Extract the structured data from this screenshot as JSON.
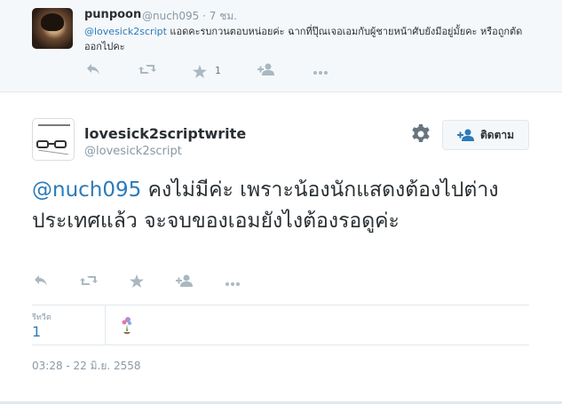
{
  "reply_tweet": {
    "name": "punpoon",
    "handle": "@nuch095",
    "time": "· 7 ชม.",
    "mention": "@lovesick2script",
    "text": " แอดคะรบกวนตอบหน่อยค่ะ ฉากที่ปุ๊ณเจอเอมกับผู้ชายหน้าศับยังมีอยู่มั้ยคะ หรือถูกตัดออกไปคะ",
    "favorite_count": "1",
    "icons": [
      "reply-icon",
      "retweet-icon",
      "favorite-icon",
      "follow-icon",
      "more-icon"
    ]
  },
  "main_tweet": {
    "name": "lovesick2scriptwrite",
    "handle": "@lovesick2script",
    "follow_label": "ติดตาม",
    "mention": "@nuch095",
    "text": " คงไม่มีค่ะ เพราะน้องนักแสดงต้องไปต่างประเทศแล้ว จะจบของเอมยังไงต้องรอดูค่ะ",
    "stats_label": "รีทวีต",
    "stats_value": "1",
    "timestamp": "03:28 - 22 มิ.ย. 2558",
    "icons": [
      "gear-icon",
      "reply-icon",
      "retweet-icon",
      "favorite-icon",
      "follow-icon",
      "more-icon"
    ]
  },
  "colors": {
    "link": "#2b7bb9",
    "muted": "#8899a6",
    "icon": "#aab8c2",
    "reply_bg": "#f5f8fa",
    "border": "#e1e8ed"
  }
}
